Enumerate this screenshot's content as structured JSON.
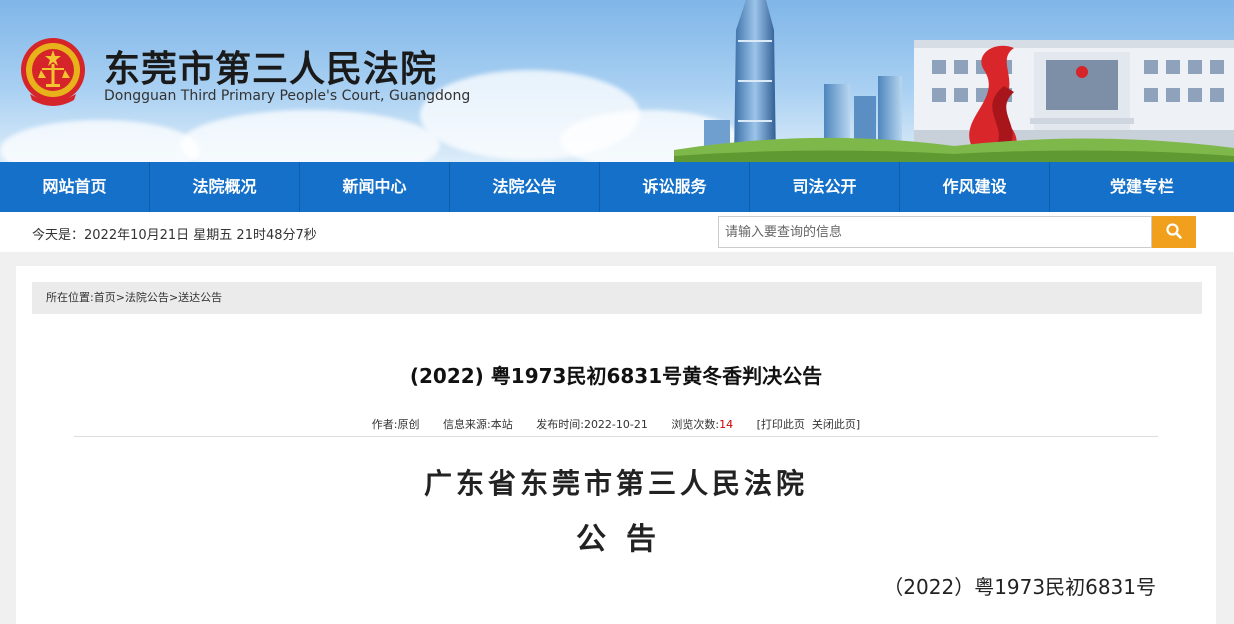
{
  "header": {
    "title": "东莞市第三人民法院",
    "subtitle": "Dongguan Third Primary People's Court, Guangdong"
  },
  "nav": {
    "items": [
      {
        "label": "网站首页"
      },
      {
        "label": "法院概况"
      },
      {
        "label": "新闻中心"
      },
      {
        "label": "法院公告"
      },
      {
        "label": "诉讼服务"
      },
      {
        "label": "司法公开"
      },
      {
        "label": "作风建设"
      },
      {
        "label": "党建专栏"
      }
    ]
  },
  "toprow": {
    "date_text": "今天是：2022年10月21日 星期五 21时48分7秒",
    "search_placeholder": "请输入要查询的信息"
  },
  "breadcrumb": {
    "prefix": "所在位置:",
    "items": [
      "首页",
      "法院公告",
      "送达公告"
    ],
    "sep": ">"
  },
  "article": {
    "title": "(2022) 粤1973民初6831号黄冬香判决公告",
    "author": "作者:原创",
    "source": "信息来源:本站",
    "published": "发布时间:2022-10-21",
    "views_label": "浏览次数:",
    "views": "14",
    "print": "[打印此页",
    "close": "关闭此页]",
    "court_name": "广东省东莞市第三人民法院",
    "notice": "公告",
    "case_no": "（2022）粤1973民初6831号"
  },
  "colors": {
    "nav_bg": "#1470c9",
    "search_button": "#f0a01c",
    "views": "#cc0000"
  }
}
